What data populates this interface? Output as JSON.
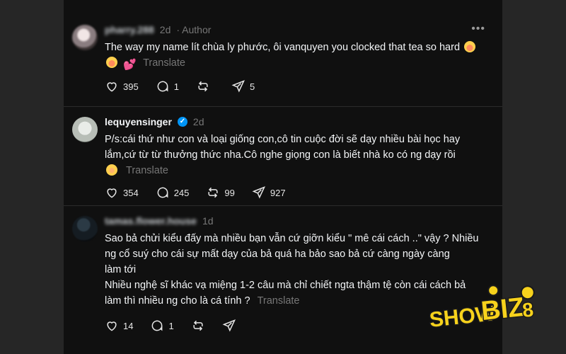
{
  "comments": [
    {
      "username": "pharry.288",
      "time": "2d",
      "author_label": "· Author",
      "text": "The way my name lít chùa ly phước, ôi vanquyen you clocked that tea so hard",
      "translate": "Translate",
      "likes": "395",
      "replies": "1",
      "reposts": "",
      "shares": "5"
    },
    {
      "username": "lequyensinger",
      "verified": true,
      "time": "2d",
      "text": "P/s:cái thứ như con và loại giống con,cô tin cuộc đời sẽ dạy nhiều bài học hay lắm,cứ từ từ thưởng thức nha.Cô nghe giọng con là biết nhà ko có ng dạy rồi",
      "translate": "Translate",
      "likes": "354",
      "replies": "245",
      "reposts": "99",
      "shares": "927"
    },
    {
      "username": "tamas.flower.house",
      "time": "1d",
      "text_lines": [
        "Sao bả chửi kiểu đấy mà nhiều bạn vẫn cứ giỡn kiểu \" mê cái cách ..\" vậy ? Nhiều",
        "ng cổ suý cho cái sự mất dạy của bả quá ha bảo sao bả cứ càng ngày càng",
        "làm tới",
        "Nhiều nghệ sĩ khác vạ miệng 1-2 câu mà chỉ chiết ngta thậm tệ còn cái cách bả",
        "làm thì nhiều ng cho là cá tính ?"
      ],
      "translate": "Translate",
      "likes": "14",
      "replies": "1",
      "reposts": "",
      "shares": ""
    }
  ],
  "watermark": {
    "text_a": "SHOW",
    "text_b": "BIZ",
    "text_c": "8",
    "colors": {
      "yellow": "#f7d21c",
      "dark": "#1a1a1a"
    }
  },
  "colors": {
    "background": "#101010",
    "outer": "#262626",
    "text": "#f3f5f7",
    "muted": "#777777",
    "verified": "#0095f6"
  },
  "icons": [
    "heart-icon",
    "comment-icon",
    "repost-icon",
    "share-icon",
    "more-icon",
    "verified-icon"
  ]
}
